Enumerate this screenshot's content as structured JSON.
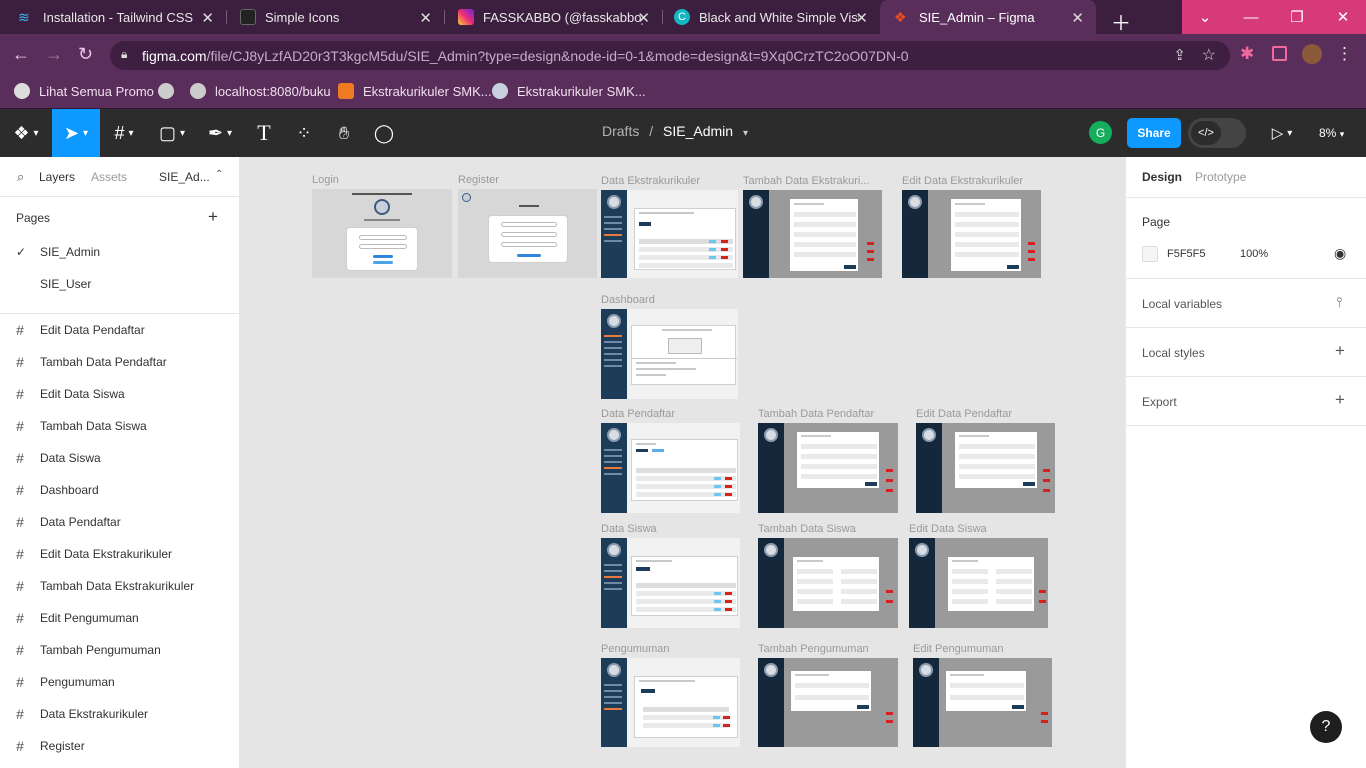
{
  "browser": {
    "tabs": [
      {
        "title": "Installation - Tailwind CSS"
      },
      {
        "title": "Simple Icons"
      },
      {
        "title": "FASSKABBO (@fasskabbo_) • Instagram"
      },
      {
        "title": "Black and White Simple Visual"
      },
      {
        "title": "SIE_Admin – Figma"
      }
    ],
    "url_host": "figma.com",
    "url_rest": "/file/CJ8yLzfAD20r3T3kgcM5du/SIE_Admin?type=design&node-id=0-1&mode=design&t=9Xq0CrzTC2oO07DN-0",
    "bookmarks": [
      {
        "label": "Lihat Semua Promo"
      },
      {
        "label": ""
      },
      {
        "label": "localhost:8080/buku"
      },
      {
        "label": "Ekstrakurikuler SMK..."
      },
      {
        "label": "Ekstrakurikuler SMK..."
      }
    ]
  },
  "toolbar": {
    "breadcrumb_parent": "Drafts",
    "breadcrumb_sep": "/",
    "file_name": "SIE_Admin",
    "avatar_initial": "G",
    "share_label": "Share",
    "zoom": "8%"
  },
  "left_panel": {
    "tabs": {
      "layers": "Layers",
      "assets": "Assets",
      "page": "SIE_Ad..."
    },
    "pages_header": "Pages",
    "pages": [
      {
        "name": "SIE_Admin",
        "selected": true
      },
      {
        "name": "SIE_User",
        "selected": false
      }
    ],
    "layers": [
      "Edit Data Pendaftar",
      "Tambah Data Pendaftar",
      "Edit Data Siswa",
      "Tambah Data Siswa",
      "Data Siswa",
      "Dashboard",
      "Data Pendaftar",
      "Edit Data Ekstrakurikuler",
      "Tambah Data Ekstrakurikuler",
      "Edit Pengumuman",
      "Tambah Pengumuman",
      "Pengumuman",
      "Data Ekstrakurikuler",
      "Register"
    ]
  },
  "right_panel": {
    "tab_design": "Design",
    "tab_prototype": "Prototype",
    "page_header": "Page",
    "bg_color": "F5F5F5",
    "bg_opacity": "100%",
    "local_variables": "Local variables",
    "local_styles": "Local styles",
    "export": "Export"
  },
  "canvas": {
    "frames": {
      "login": "Login",
      "register": "Register",
      "data_ekstrakurikuler": "Data Ekstrakurikuler",
      "tambah_data_ekstrakurikuler": "Tambah Data Ekstrakuri...",
      "edit_data_ekstrakurikuler": "Edit Data Ekstrakurikuler",
      "dashboard": "Dashboard",
      "data_pendaftar": "Data Pendaftar",
      "tambah_data_pendaftar": "Tambah Data Pendaftar",
      "edit_data_pendaftar": "Edit Data Pendaftar",
      "data_siswa": "Data Siswa",
      "tambah_data_siswa": "Tambah Data Siswa",
      "edit_data_siswa": "Edit Data Siswa",
      "pengumuman": "Pengumuman",
      "tambah_pengumuman": "Tambah Pengumuman",
      "edit_pengumuman": "Edit Pengumuman"
    }
  },
  "help_label": "?"
}
